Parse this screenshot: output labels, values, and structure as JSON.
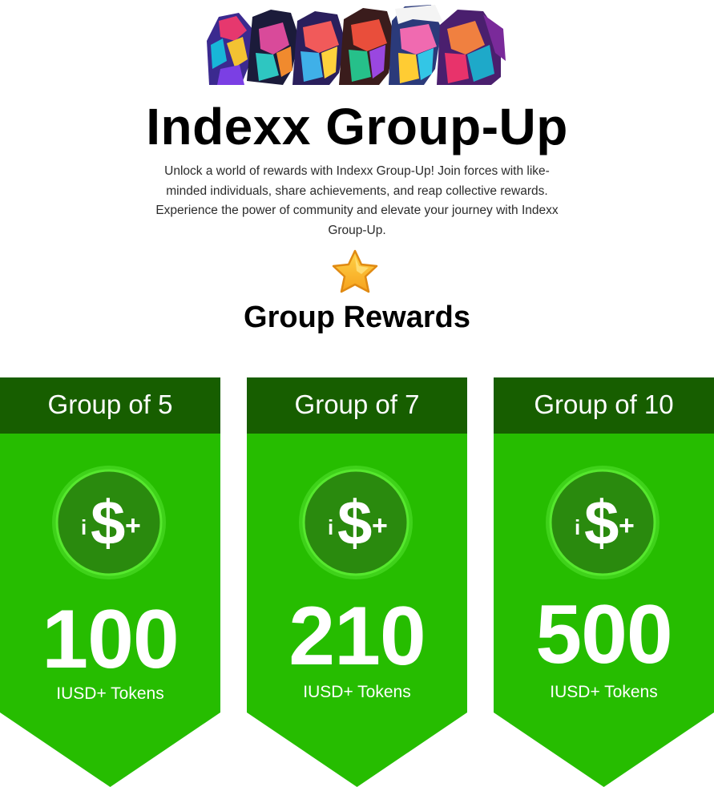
{
  "hero": {
    "image": "portrait-collage-illustration"
  },
  "header": {
    "title": "Indexx Group-Up",
    "intro": "Unlock a world of rewards with Indexx Group-Up! Join forces with like-minded individuals, share achievements, and reap collective rewards. Experience the power of community and elevate your journey with Indexx Group-Up."
  },
  "section": {
    "icon": "star-icon",
    "title": "Group Rewards"
  },
  "colors": {
    "card_body": "#26bd00",
    "card_header": "#175e00",
    "coin_outer": "#4fe02a",
    "coin_inner": "#2a8a0e",
    "text_on_card": "#ffffff"
  },
  "cards": [
    {
      "title": "Group of 5",
      "coin_icon": "iusd-plus-coin-icon",
      "amount": "100",
      "unit": "IUSD+ Tokens"
    },
    {
      "title": "Group of 7",
      "coin_icon": "iusd-plus-coin-icon",
      "amount": "210",
      "unit": "IUSD+ Tokens"
    },
    {
      "title": "Group of 10",
      "coin_icon": "iusd-plus-coin-icon",
      "amount": "500",
      "unit": "IUSD+ Tokens"
    }
  ]
}
